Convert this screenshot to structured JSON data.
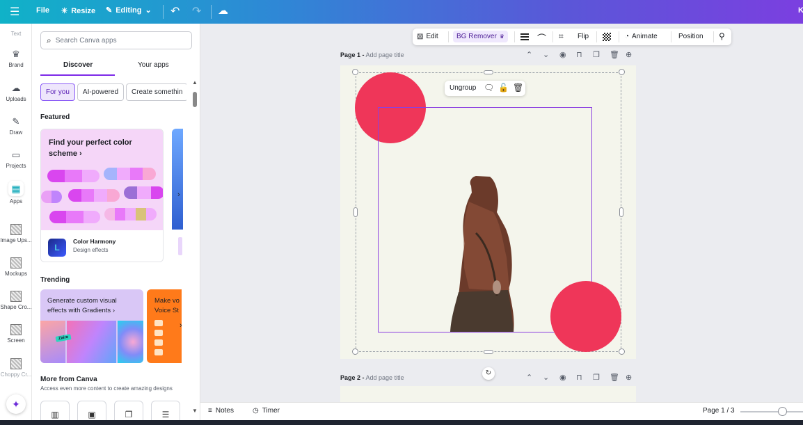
{
  "topbar": {
    "menu_icon": "hamburger-icon",
    "file": "File",
    "resize": "Resize",
    "editing": "Editing",
    "avatar_initial": "K"
  },
  "rail": {
    "items": [
      {
        "label": "Text",
        "icon": "text-icon"
      },
      {
        "label": "Brand",
        "icon": "crown-icon"
      },
      {
        "label": "Uploads",
        "icon": "upload-cloud-icon"
      },
      {
        "label": "Draw",
        "icon": "pen-icon"
      },
      {
        "label": "Projects",
        "icon": "folder-icon"
      },
      {
        "label": "Apps",
        "icon": "apps-grid-icon"
      },
      {
        "label": "Image Ups...",
        "icon": "image-upscaler-icon"
      },
      {
        "label": "Mockups",
        "icon": "mockups-icon"
      },
      {
        "label": "Shape Cro...",
        "icon": "shape-crop-icon"
      },
      {
        "label": "Screen",
        "icon": "screen-icon"
      },
      {
        "label": "Choppy Cr...",
        "icon": "choppy-crop-icon"
      }
    ]
  },
  "panel": {
    "search_placeholder": "Search Canva apps",
    "tabs": [
      "Discover",
      "Your apps"
    ],
    "chips": [
      "For you",
      "AI-powered",
      "Create somethin"
    ],
    "featured_heading": "Featured",
    "featured_card": {
      "title": "Find your perfect color scheme",
      "app_name": "Color Harmony",
      "app_desc": "Design effects"
    },
    "trending_heading": "Trending",
    "trending_card": {
      "title": "Generate custom visual effects with Gradients",
      "tag": "Zaire"
    },
    "trending_card2": {
      "title_line1": "Make vo",
      "title_line2": "Voice St"
    },
    "more_heading": "More from Canva",
    "more_sub": "Access even more content to create amazing designs"
  },
  "context_toolbar": {
    "edit": "Edit",
    "bg_remover": "BG Remover",
    "flip": "Flip",
    "animate": "Animate",
    "position": "Position"
  },
  "page1": {
    "label": "Page 1 -",
    "title_placeholder": "Add page title"
  },
  "page2": {
    "label": "Page 2 -",
    "title_placeholder": "Add page title"
  },
  "selection": {
    "ungroup": "Ungroup"
  },
  "colors": {
    "accent_circle": "#ef3659",
    "selection_purple": "#8b3fe0",
    "page_bg": "#f4f5ec"
  },
  "bottombar": {
    "notes": "Notes",
    "timer": "Timer",
    "page_indicator": "Page 1 / 3"
  }
}
